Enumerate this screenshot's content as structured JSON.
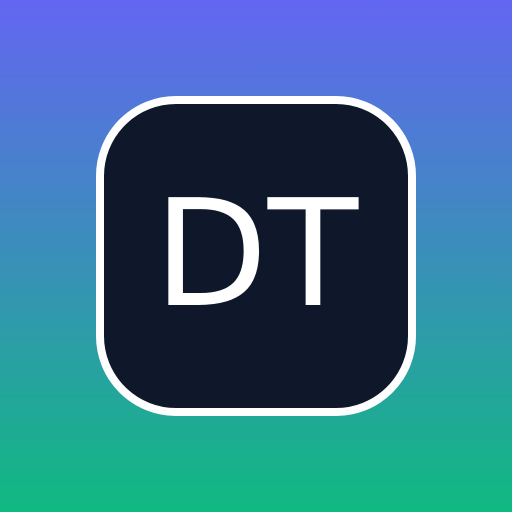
{
  "icon": {
    "initials": "DT",
    "colors": {
      "background_top": "#6366F1",
      "background_bottom": "#10B981",
      "tile_fill": "#0F172A",
      "tile_border": "#FFFFFF",
      "text": "#FFFFFF"
    }
  }
}
